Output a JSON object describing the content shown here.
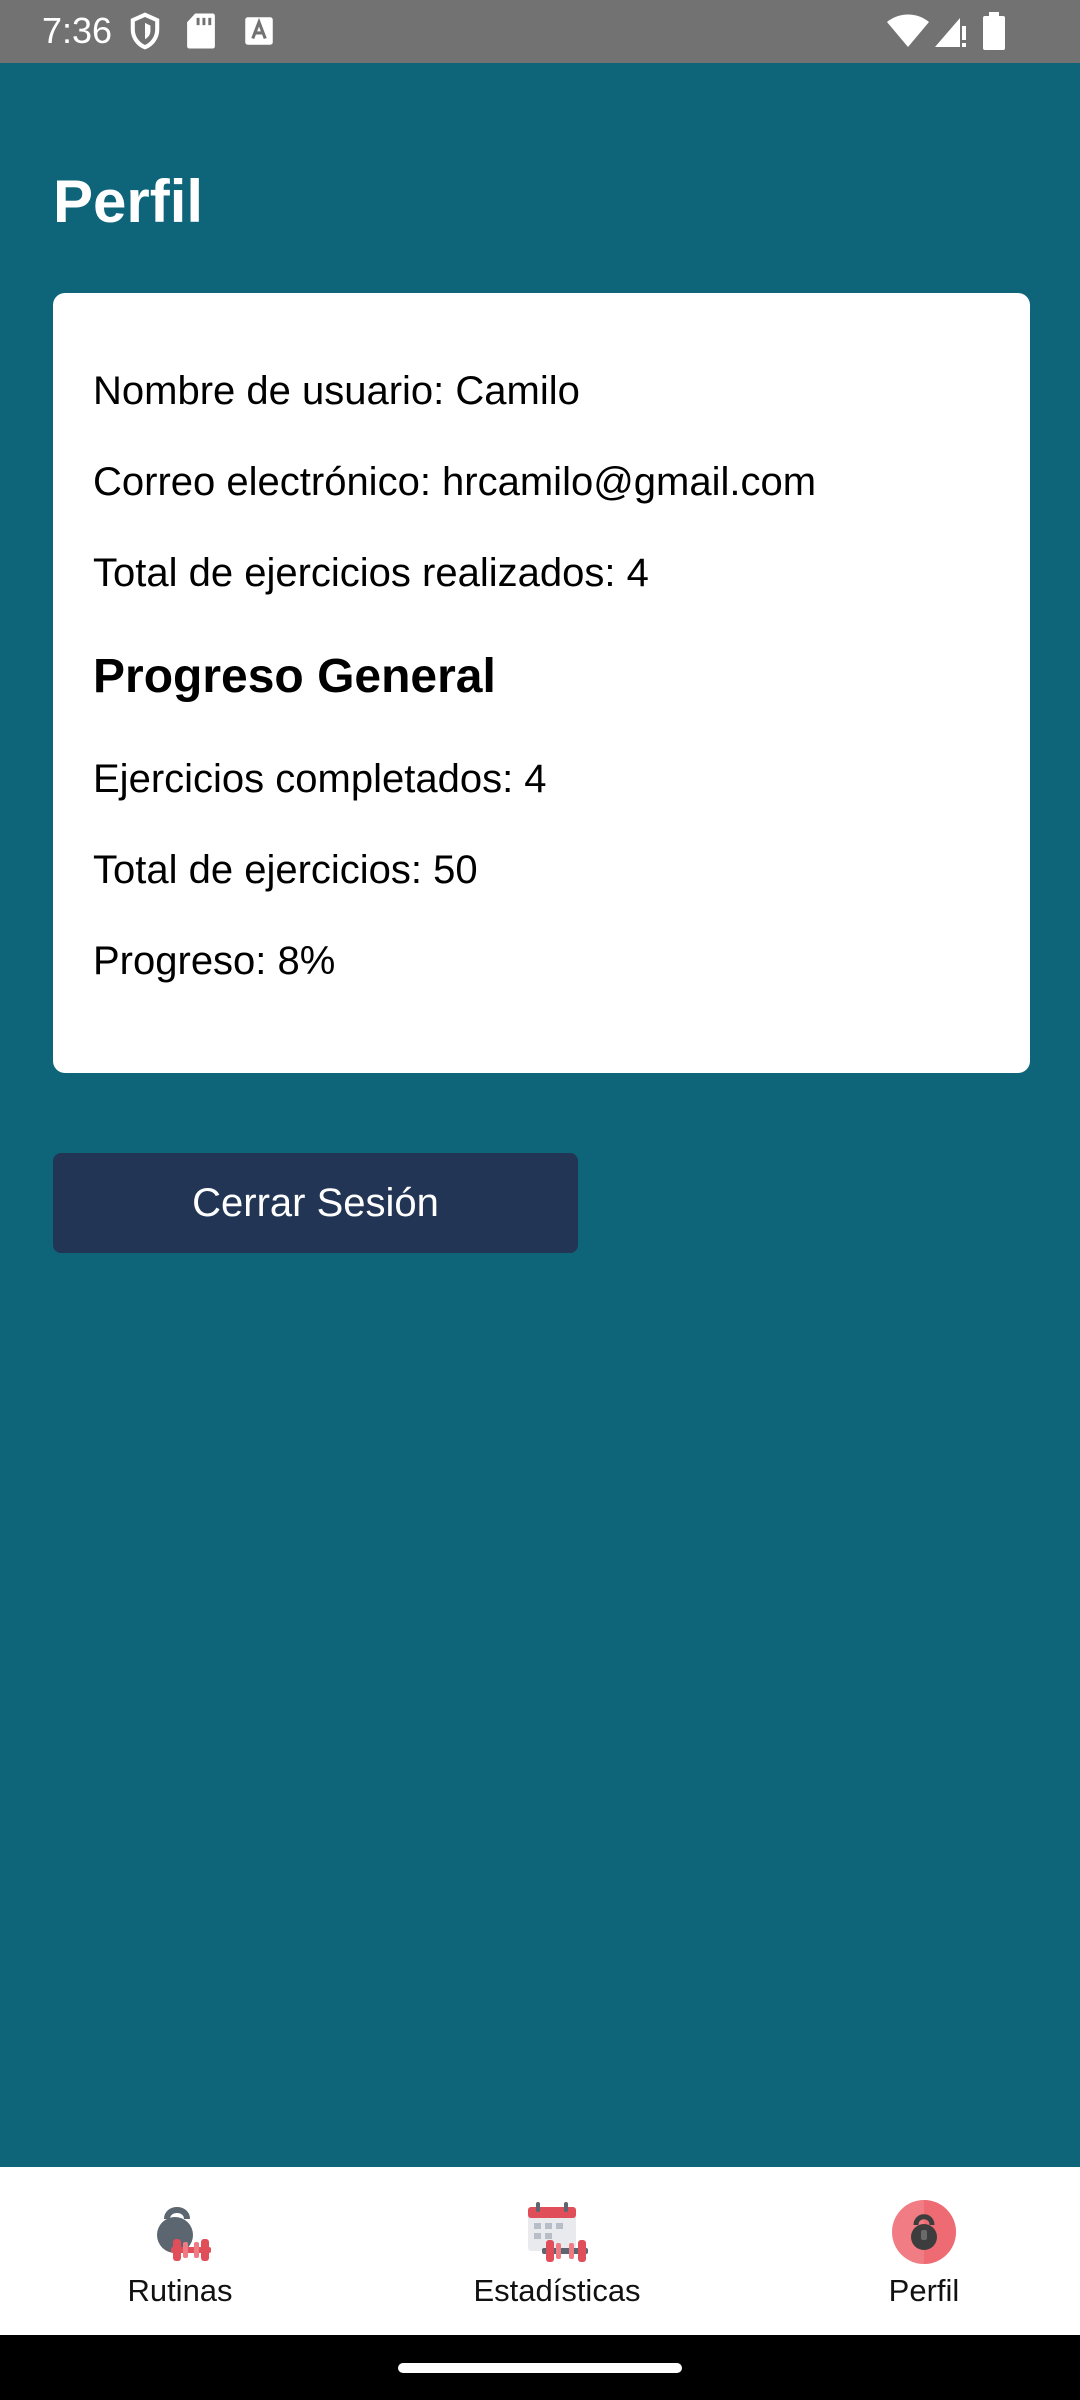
{
  "status_bar": {
    "time": "7:36",
    "icons_left": [
      "shield-icon",
      "sd-card-icon",
      "font-a-icon"
    ],
    "icons_right": [
      "wifi-icon",
      "signal-icon",
      "battery-icon"
    ]
  },
  "colors": {
    "background": "#0e6478",
    "card": "#ffffff",
    "button": "#223555",
    "status_bar": "#727272"
  },
  "header": {
    "title": "Perfil"
  },
  "profile": {
    "username": "Nombre de usuario: Camilo",
    "email": "Correo electrónico: hrcamilo@gmail.com",
    "total_done": "Total de ejercicios realizados: 4",
    "progress_heading": "Progreso General",
    "completed": "Ejercicios completados: 4",
    "total_exercises": "Total de ejercicios: 50",
    "progress": "Progreso: 8%"
  },
  "actions": {
    "logout_label": "Cerrar Sesión"
  },
  "bottom_nav": {
    "items": [
      {
        "label": "Rutinas",
        "icon": "kettlebell-dumbbell-icon",
        "active": false
      },
      {
        "label": "Estadísticas",
        "icon": "calendar-dumbbell-icon",
        "active": false
      },
      {
        "label": "Perfil",
        "icon": "kettlebell-profile-icon",
        "active": true
      }
    ]
  }
}
